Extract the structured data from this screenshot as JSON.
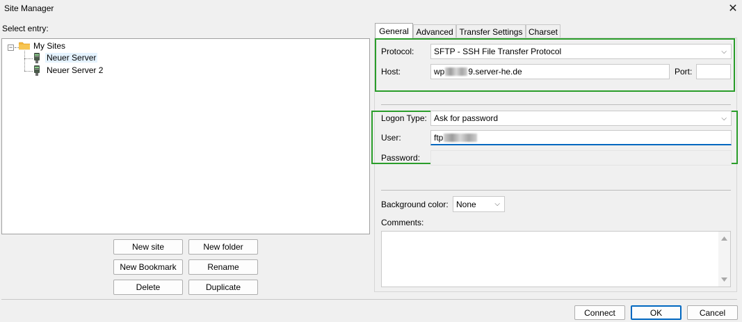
{
  "window": {
    "title": "Site Manager",
    "close_glyph": "✕"
  },
  "left": {
    "select_entry_label": "Select entry:",
    "tree": {
      "root": {
        "label": "My Sites",
        "expander": "−"
      },
      "items": [
        {
          "label": "Neuer Server",
          "selected": true
        },
        {
          "label": "Neuer Server 2",
          "selected": false
        }
      ]
    },
    "buttons": {
      "new_site": "New site",
      "new_folder": "New folder",
      "new_bookmark": "New Bookmark",
      "rename": "Rename",
      "delete": "Delete",
      "duplicate": "Duplicate"
    }
  },
  "tabs": [
    {
      "label": "General",
      "active": true
    },
    {
      "label": "Advanced",
      "active": false
    },
    {
      "label": "Transfer Settings",
      "active": false
    },
    {
      "label": "Charset",
      "active": false
    }
  ],
  "general": {
    "protocol_label": "Protocol:",
    "protocol_value": "SFTP - SSH File Transfer Protocol",
    "host_label": "Host:",
    "host_prefix": "wp",
    "host_suffix": "9.server-he.de",
    "port_label": "Port:",
    "port_value": "",
    "logon_type_label": "Logon Type:",
    "logon_type_value": "Ask for password",
    "user_label": "User:",
    "user_prefix": "ftp",
    "password_label": "Password:",
    "background_color_label": "Background color:",
    "background_color_value": "None",
    "comments_label": "Comments:",
    "comments_value": ""
  },
  "footer": {
    "connect": "Connect",
    "ok": "OK",
    "cancel": "Cancel"
  },
  "colors": {
    "highlight_box": "#2a9d2a",
    "focus_underline": "#0067c0",
    "folder": "#f4b63a"
  }
}
